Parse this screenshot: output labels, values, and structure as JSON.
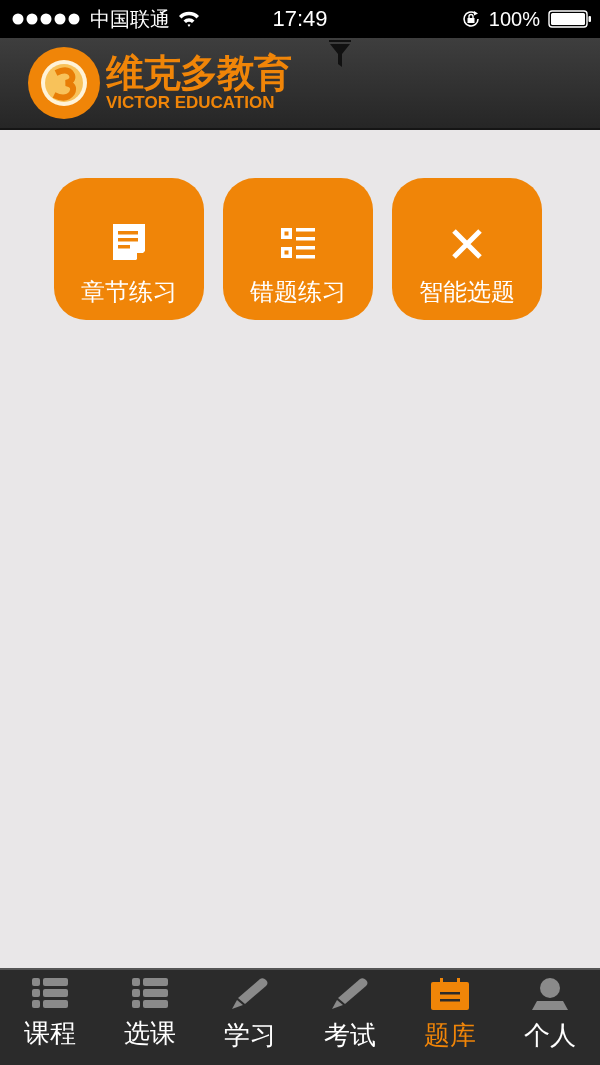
{
  "status_bar": {
    "carrier": "中国联通",
    "time": "17:49",
    "battery": "100%"
  },
  "header": {
    "brand": "维克多教育",
    "brand_en": "VICTOR EDUCATION"
  },
  "actions": [
    {
      "label": "章节练习",
      "kind": "document"
    },
    {
      "label": "错题练习",
      "kind": "list"
    },
    {
      "label": "智能选题",
      "kind": "cross"
    }
  ],
  "tab_bar": [
    {
      "label": "课程",
      "kind": "list",
      "selected": false
    },
    {
      "label": "选课",
      "kind": "list",
      "selected": false
    },
    {
      "label": "学习",
      "kind": "pencil",
      "selected": false
    },
    {
      "label": "考试",
      "kind": "pencil",
      "selected": false
    },
    {
      "label": "题库",
      "kind": "calendar",
      "selected": true
    },
    {
      "label": "个人",
      "kind": "person",
      "selected": false
    }
  ]
}
